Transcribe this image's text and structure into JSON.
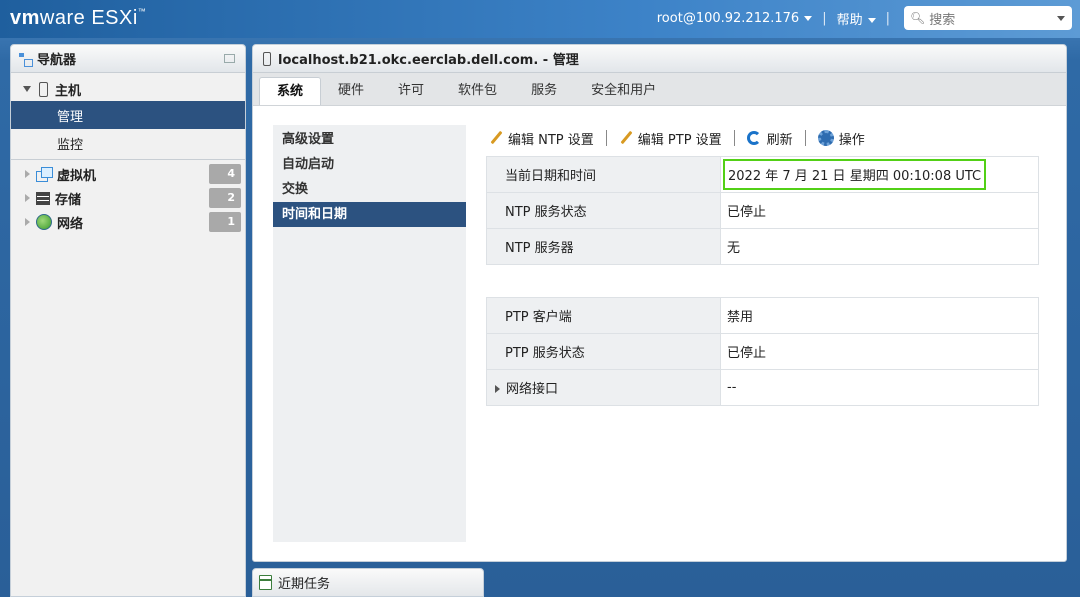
{
  "brand": {
    "vm": "vm",
    "ware": "ware",
    "esxi": "ESXi",
    "tm": "™"
  },
  "topbar": {
    "user": "root@100.92.212.176",
    "sep": "|",
    "help": "帮助",
    "search_placeholder": "搜索"
  },
  "navigator": {
    "title": "导航器",
    "host": {
      "label": "主机",
      "items": [
        {
          "label": "管理",
          "active": true
        },
        {
          "label": "监控",
          "active": false
        }
      ]
    },
    "groups": [
      {
        "label": "虚拟机",
        "count": "4"
      },
      {
        "label": "存储",
        "count": "2"
      },
      {
        "label": "网络",
        "count": "1"
      }
    ]
  },
  "main": {
    "title": "localhost.b21.okc.eerclab.dell.com. - 管理",
    "tabs": [
      "系统",
      "硬件",
      "许可",
      "软件包",
      "服务",
      "安全和用户"
    ],
    "active_tab": "系统",
    "side_menu": [
      "高级设置",
      "自动启动",
      "交换",
      "时间和日期"
    ],
    "active_side": "时间和日期",
    "toolbar": {
      "edit_ntp": "编辑 NTP 设置",
      "edit_ptp": "编辑 PTP 设置",
      "refresh": "刷新",
      "actions": "操作"
    },
    "ntp_table": [
      {
        "key": "当前日期和时间",
        "value": "2022 年 7 月 21 日 星期四 00:10:08 UTC"
      },
      {
        "key": "NTP 服务状态",
        "value": "已停止"
      },
      {
        "key": "NTP 服务器",
        "value": "无"
      }
    ],
    "ptp_table": [
      {
        "key": "PTP 客户端",
        "value": "禁用"
      },
      {
        "key": "PTP 服务状态",
        "value": "已停止"
      },
      {
        "key": "网络接口",
        "value": "--"
      }
    ]
  },
  "bottom": {
    "recent_tasks": "近期任务"
  },
  "colors": {
    "accent": "#2c5280",
    "highlight": "#52d016",
    "topbar": "#3d83c8"
  }
}
